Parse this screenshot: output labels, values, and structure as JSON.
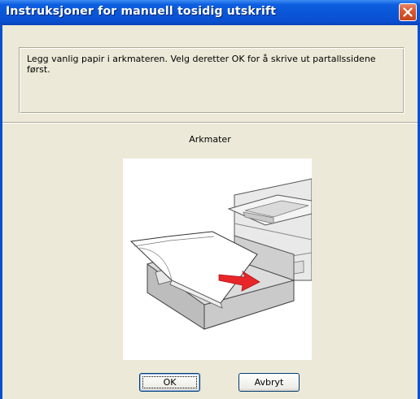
{
  "window": {
    "title": "Instruksjoner for manuell tosidig utskrift"
  },
  "instructions": {
    "text": "Legg vanlig papir i arkmateren. Velg deretter OK for å skrive ut partallssidene først."
  },
  "illustration": {
    "label": "Arkmater",
    "icon": "printer-paper-tray-illustration"
  },
  "buttons": {
    "ok_label": "OK",
    "cancel_label": "Avbryt"
  },
  "colors": {
    "titlebar": "#0A4FD0",
    "close_button": "#DB5A33",
    "dialog_background": "#ECE9D8",
    "arrow": "#E8262A"
  }
}
